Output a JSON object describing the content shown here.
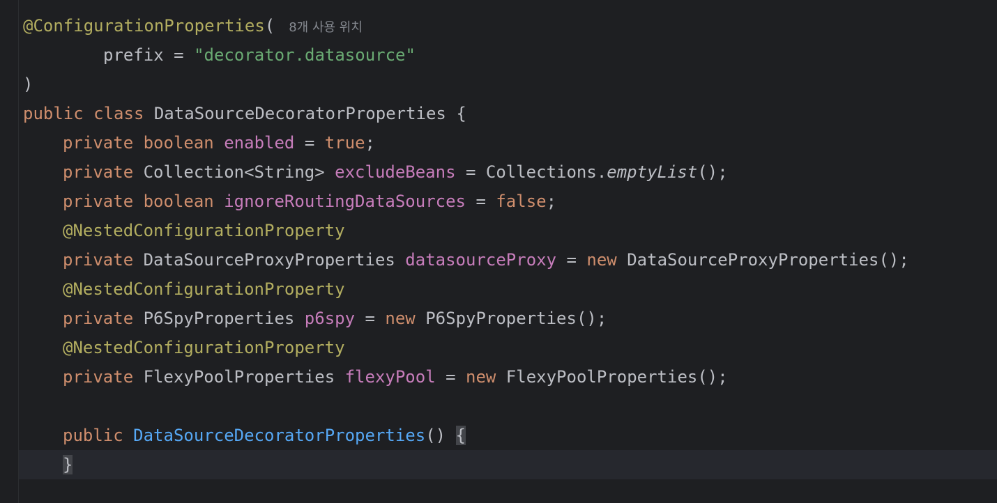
{
  "editor": {
    "lines": [
      {
        "tokens": [
          "@ConfigurationProperties",
          "("
        ],
        "hint": "8개 사용 위치"
      },
      {
        "tokens": [
          "prefix",
          " = ",
          "\"decorator.datasource\""
        ]
      },
      {
        "tokens": [
          ")"
        ]
      },
      {
        "tokens": [
          "public",
          " ",
          "class",
          " DataSourceDecoratorProperties {"
        ]
      },
      {
        "tokens": [
          "private",
          " ",
          "boolean",
          " ",
          "enabled",
          " = ",
          "true",
          ";"
        ]
      },
      {
        "tokens": [
          "private",
          " Collection<String> ",
          "excludeBeans",
          " = Collections.",
          "emptyList",
          "();"
        ]
      },
      {
        "tokens": [
          "private",
          " ",
          "boolean",
          " ",
          "ignoreRoutingDataSources",
          " = ",
          "false",
          ";"
        ]
      },
      {
        "tokens": [
          "@NestedConfigurationProperty"
        ]
      },
      {
        "tokens": [
          "private",
          " DataSourceProxyProperties ",
          "datasourceProxy",
          " = ",
          "new",
          " DataSourceProxyProperties();"
        ]
      },
      {
        "tokens": [
          "@NestedConfigurationProperty"
        ]
      },
      {
        "tokens": [
          "private",
          " P6SpyProperties ",
          "p6spy",
          " = ",
          "new",
          " P6SpyProperties();"
        ]
      },
      {
        "tokens": [
          "@NestedConfigurationProperty"
        ]
      },
      {
        "tokens": [
          "private",
          " FlexyPoolProperties ",
          "flexyPool",
          " = ",
          "new",
          " FlexyPoolProperties();"
        ]
      },
      {
        "tokens": []
      },
      {
        "tokens": [
          "public",
          " ",
          "DataSourceDecoratorProperties",
          "() ",
          "{"
        ]
      },
      {
        "tokens": [
          "}"
        ]
      }
    ]
  },
  "colors": {
    "background": "#1e1f22",
    "keyword": "#cf8e6d",
    "annotation": "#b3ae60",
    "string": "#6aab73",
    "field": "#c77dbb",
    "method": "#56a8f5",
    "text": "#bcbec4",
    "hint": "#868a91",
    "current_line": "#26282e"
  }
}
